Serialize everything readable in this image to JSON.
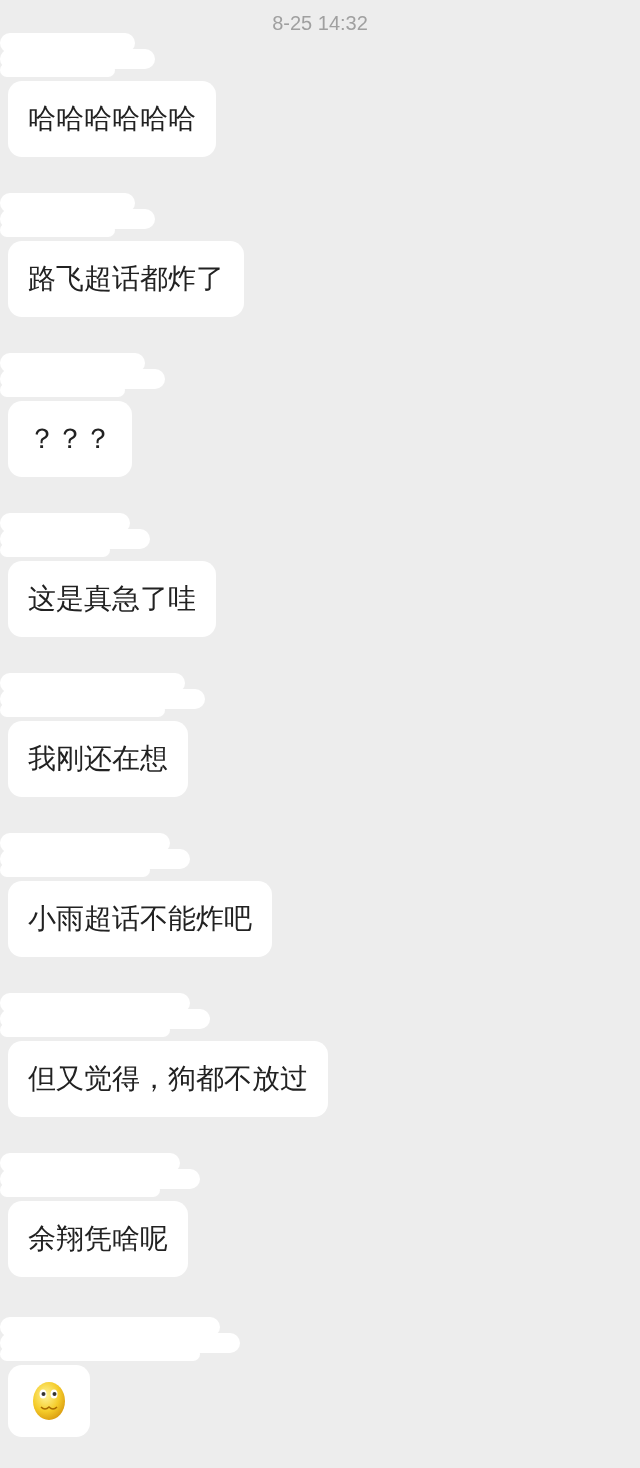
{
  "timestamp": "8-25 14:32",
  "messages": [
    {
      "kind": "text",
      "sender_redacted": true,
      "text": "哈哈哈哈哈哈"
    },
    {
      "kind": "text",
      "sender_redacted": true,
      "text": "路飞超话都炸了"
    },
    {
      "kind": "text",
      "sender_redacted": true,
      "text": "？？？"
    },
    {
      "kind": "text",
      "sender_redacted": true,
      "text": "这是真急了哇"
    },
    {
      "kind": "text",
      "sender_redacted": true,
      "text": "我刚还在想"
    },
    {
      "kind": "text",
      "sender_redacted": true,
      "text": "小雨超话不能炸吧"
    },
    {
      "kind": "text",
      "sender_redacted": true,
      "text": "但又觉得，狗都不放过"
    },
    {
      "kind": "text",
      "sender_redacted": true,
      "text": "余翔凭啥呢"
    },
    {
      "kind": "emoji",
      "sender_redacted": true
    }
  ]
}
